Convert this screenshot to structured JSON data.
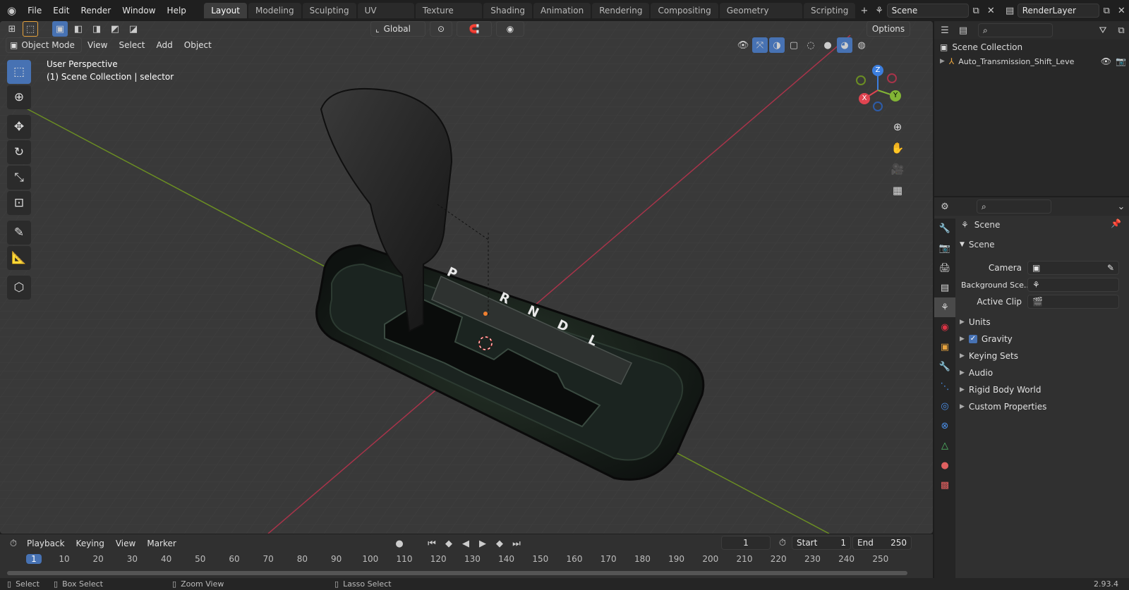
{
  "topbar": {
    "menus": [
      "File",
      "Edit",
      "Render",
      "Window",
      "Help"
    ],
    "workspaces": [
      "Layout",
      "Modeling",
      "Sculpting",
      "UV Editing",
      "Texture Paint",
      "Shading",
      "Animation",
      "Rendering",
      "Compositing",
      "Geometry Nodes",
      "Scripting"
    ],
    "active_workspace": "Layout",
    "add_symbol": "+",
    "scene_name": "Scene",
    "view_layer": "RenderLayer"
  },
  "viewport": {
    "mode": "Object Mode",
    "menus": [
      "View",
      "Select",
      "Add",
      "Object"
    ],
    "transform_orientation": "Global",
    "options_label": "Options",
    "overlay_line1": "User Perspective",
    "overlay_line2": "(1) Scene Collection | selector",
    "gizmo_axes": {
      "x": "X",
      "y": "Y",
      "z": "Z"
    },
    "shifter_letters": [
      "P",
      "R",
      "N",
      "D",
      "L"
    ],
    "colors": {
      "x_axis": "#a8344a",
      "y_axis": "#6b8e23",
      "grid": "#424242",
      "bg": "#393939"
    }
  },
  "timeline": {
    "menus": [
      "Playback",
      "Keying",
      "View",
      "Marker"
    ],
    "current_frame": "1",
    "start_label": "Start",
    "start_value": "1",
    "end_label": "End",
    "end_value": "250",
    "ticks": [
      "1",
      "10",
      "20",
      "30",
      "40",
      "50",
      "60",
      "70",
      "80",
      "90",
      "100",
      "110",
      "120",
      "130",
      "140",
      "150",
      "160",
      "170",
      "180",
      "190",
      "200",
      "210",
      "220",
      "230",
      "240",
      "250"
    ]
  },
  "outliner": {
    "root": "Scene Collection",
    "items": [
      {
        "name": "Auto_Transmission_Shift_Leve"
      }
    ]
  },
  "properties": {
    "context_title": "Scene",
    "section": "Scene",
    "fields": [
      {
        "label": "Camera",
        "value": ""
      },
      {
        "label": "Background Sce...",
        "value": ""
      },
      {
        "label": "Active Clip",
        "value": ""
      }
    ],
    "subpanels": [
      {
        "label": "Units",
        "checkbox": false
      },
      {
        "label": "Gravity",
        "checkbox": true
      },
      {
        "label": "Keying Sets",
        "checkbox": false
      },
      {
        "label": "Audio",
        "checkbox": false
      },
      {
        "label": "Rigid Body World",
        "checkbox": false
      },
      {
        "label": "Custom Properties",
        "checkbox": false
      }
    ]
  },
  "statusbar": {
    "hints": [
      "Select",
      "Box Select",
      "Zoom View",
      "Lasso Select"
    ],
    "version": "2.93.4"
  }
}
